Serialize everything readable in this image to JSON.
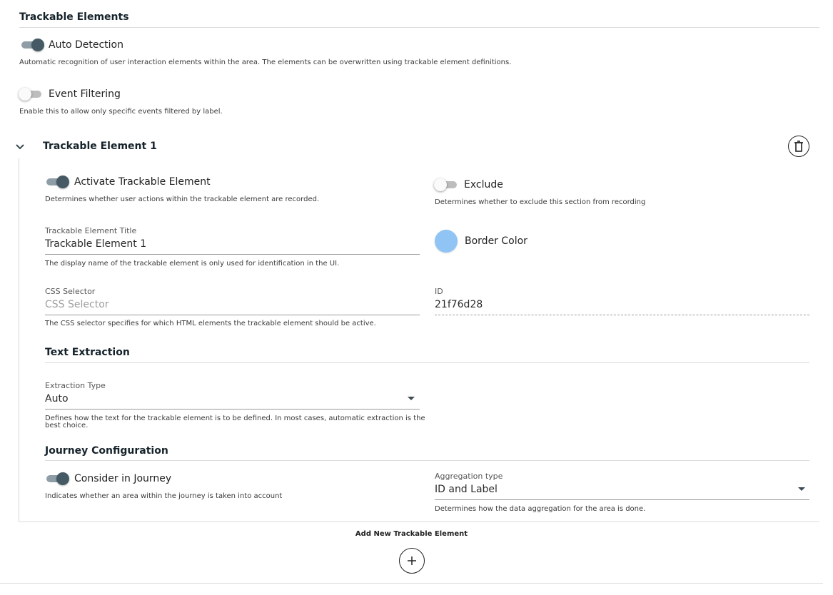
{
  "trackable_elements": {
    "title": "Trackable Elements",
    "auto_detection": {
      "label": "Auto Detection",
      "enabled": true,
      "hint": "Automatic recognition of user interaction elements within the area. The elements can be overwritten using trackable element definitions."
    },
    "event_filtering": {
      "label": "Event Filtering",
      "enabled": false,
      "hint": "Enable this to allow only specific events filtered by label."
    }
  },
  "element": {
    "title": "Trackable Element 1",
    "activate": {
      "label": "Activate Trackable Element",
      "enabled": true,
      "hint": "Determines whether user actions within the trackable element are recorded."
    },
    "exclude": {
      "label": "Exclude",
      "enabled": false,
      "hint": "Determines whether to exclude this section from recording"
    },
    "title_field": {
      "label": "Trackable Element Title",
      "value": "Trackable Element 1",
      "hint": "The display name of the trackable element is only used for identification in the UI."
    },
    "border_color": {
      "label": "Border Color",
      "color": "#90c4f4"
    },
    "css_selector": {
      "label": "CSS Selector",
      "placeholder": "CSS Selector",
      "hint": "The CSS selector specifies for which HTML elements the trackable element should be active."
    },
    "id_field": {
      "label": "ID",
      "value": "21f76d28"
    },
    "text_extraction": {
      "title": "Text Extraction",
      "extraction_type": {
        "label": "Extraction Type",
        "value": "Auto",
        "hint_line1": "Defines how the text for the trackable element is to be defined. In most cases, automatic extraction is the",
        "hint_line2": "best choice."
      }
    },
    "journey": {
      "title": "Journey Configuration",
      "consider": {
        "label": "Consider in Journey",
        "enabled": true,
        "hint": "Indicates whether an area within the journey is taken into account"
      },
      "aggregation": {
        "label": "Aggregation type",
        "value": "ID and Label",
        "hint": "Determines how the data aggregation for the area is done."
      }
    }
  },
  "footer": {
    "add_label": "Add New Trackable Element"
  },
  "icons": {
    "delete": "trash-icon",
    "add": "plus-icon",
    "collapse": "chevron-down-icon"
  }
}
